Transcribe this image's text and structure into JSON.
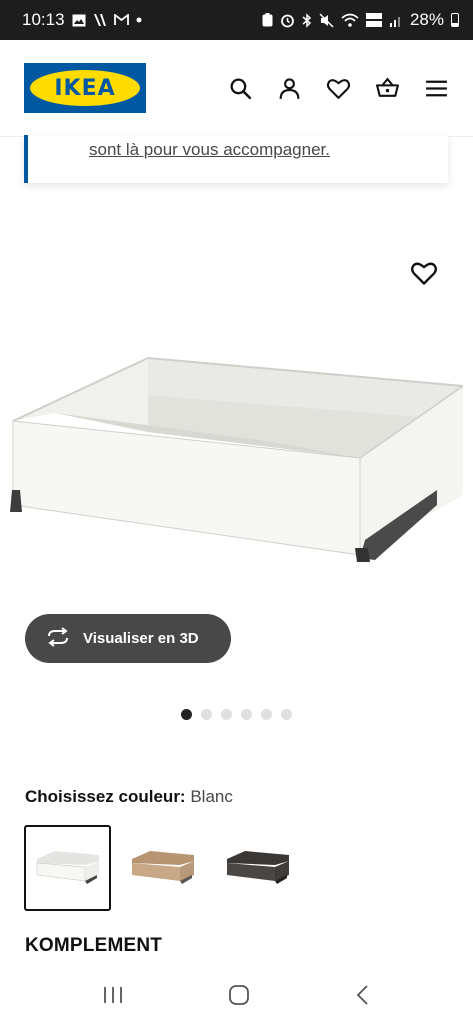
{
  "status_bar": {
    "time": "10:13",
    "battery": "28%",
    "left_icons": [
      "image-icon",
      "v-app-icon",
      "gmail-icon",
      "dot-icon"
    ],
    "right_icons": [
      "battery-saver-icon",
      "alarm-icon",
      "bluetooth-icon",
      "mute-icon",
      "wifi-icon",
      "volte-icon",
      "signal-icon"
    ]
  },
  "header": {
    "logo_text": "IKEA",
    "icons": [
      "search-icon",
      "account-icon",
      "heart-icon",
      "basket-icon",
      "menu-icon"
    ]
  },
  "notice": {
    "link_text": "sont là pour vous accompagner."
  },
  "product": {
    "visualize_label": "Visualiser en 3D",
    "carousel_dots": 6,
    "carousel_active": 0,
    "color_label": "Choisissez couleur:",
    "color_value": "Blanc",
    "swatches": [
      {
        "name": "white",
        "color": "#f2f2ee"
      },
      {
        "name": "oak",
        "color": "#c8a886"
      },
      {
        "name": "dark-grey",
        "color": "#4a4643"
      }
    ],
    "name": "KOMPLEMENT"
  },
  "colors": {
    "ikea_blue": "#0058a3",
    "ikea_yellow": "#ffdb00",
    "button_dark": "#484848"
  }
}
